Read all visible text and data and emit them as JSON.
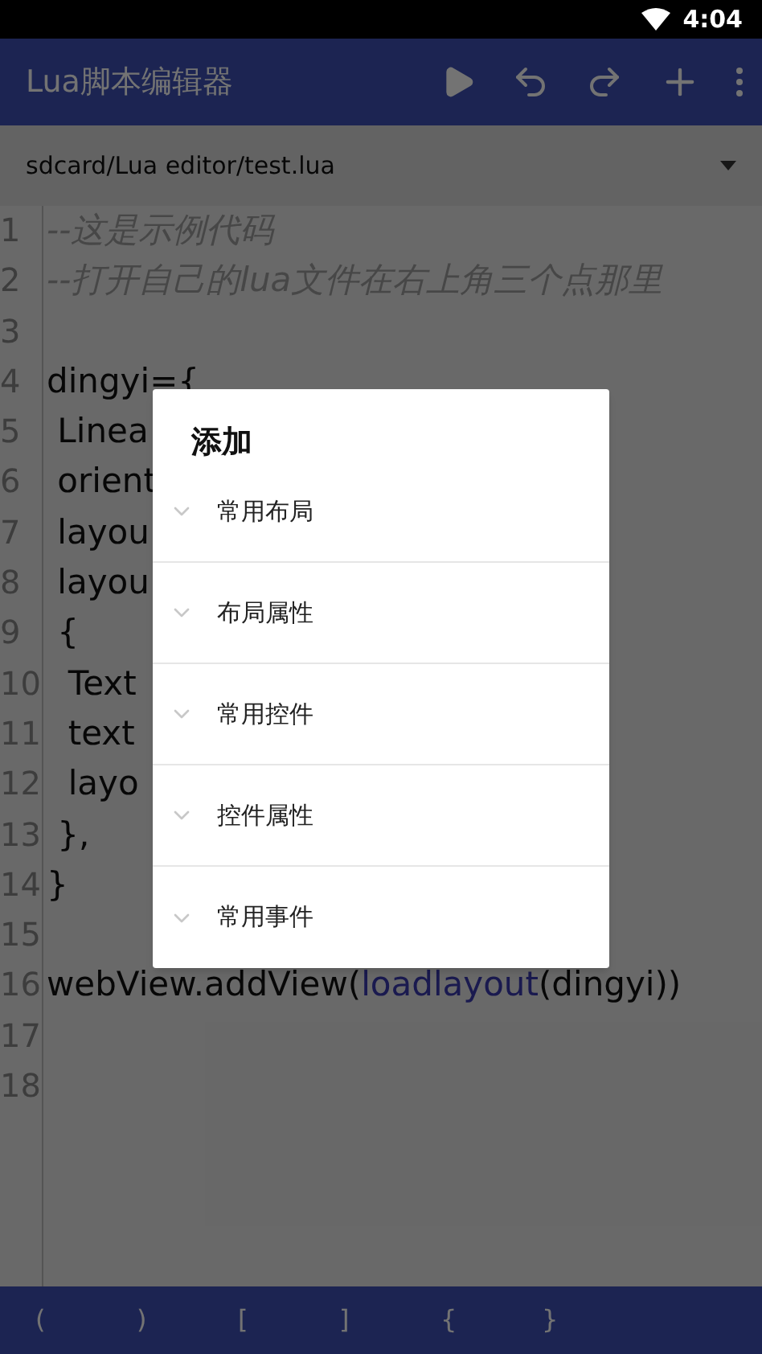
{
  "status_bar": {
    "time": "4:04"
  },
  "app_bar": {
    "title": "Lua脚本编辑器"
  },
  "file_path": {
    "value": "sdcard/Lua editor/test.lua"
  },
  "editor": {
    "lines": [
      {
        "number": "1",
        "tokens": [
          {
            "text": "--这是示例代码",
            "kind": "comment"
          }
        ]
      },
      {
        "number": "2",
        "tokens": [
          {
            "text": "--打开自己的lua文件在右上角三个点那里",
            "kind": "comment"
          }
        ]
      },
      {
        "number": "3"
      },
      {
        "number": "4",
        "tokens": [
          {
            "text": "dingyi={",
            "kind": "plain"
          }
        ]
      },
      {
        "number": "5",
        "tokens": [
          {
            "text": " Linea",
            "kind": "plain"
          }
        ]
      },
      {
        "number": "6",
        "tokens": [
          {
            "text": " orient",
            "kind": "plain"
          }
        ]
      },
      {
        "number": "7",
        "tokens": [
          {
            "text": " layou",
            "kind": "plain"
          }
        ]
      },
      {
        "number": "8",
        "tokens": [
          {
            "text": " layou",
            "kind": "plain"
          }
        ]
      },
      {
        "number": "9",
        "tokens": [
          {
            "text": " {",
            "kind": "plain"
          }
        ]
      },
      {
        "number": "10",
        "tokens": [
          {
            "text": "  Text",
            "kind": "plain"
          }
        ]
      },
      {
        "number": "11",
        "tokens": [
          {
            "text": "  text",
            "kind": "plain"
          }
        ]
      },
      {
        "number": "12",
        "tokens": [
          {
            "text": "  layo",
            "kind": "plain"
          }
        ]
      },
      {
        "number": "13",
        "tokens": [
          {
            "text": " },",
            "kind": "plain"
          }
        ]
      },
      {
        "number": "14",
        "tokens": [
          {
            "text": "}",
            "kind": "plain"
          }
        ]
      },
      {
        "number": "15"
      },
      {
        "number": "16",
        "tokens": [
          {
            "text": "webView.addView(",
            "kind": "plain"
          },
          {
            "text": "loadlayout",
            "kind": "function"
          },
          {
            "text": "(dingyi))",
            "kind": "plain"
          }
        ]
      },
      {
        "number": "17"
      },
      {
        "number": "18"
      }
    ]
  },
  "symbol_bar": [
    "(",
    ")",
    "[",
    "]",
    "{",
    "}"
  ],
  "dialog": {
    "title": "添加",
    "items": [
      {
        "label": "常用布局",
        "expanded": false
      },
      {
        "label": "布局属性",
        "expanded": false
      },
      {
        "label": "常用控件",
        "expanded": false
      },
      {
        "label": "控件属性",
        "expanded": false
      },
      {
        "label": "常用事件",
        "expanded": false
      }
    ]
  }
}
